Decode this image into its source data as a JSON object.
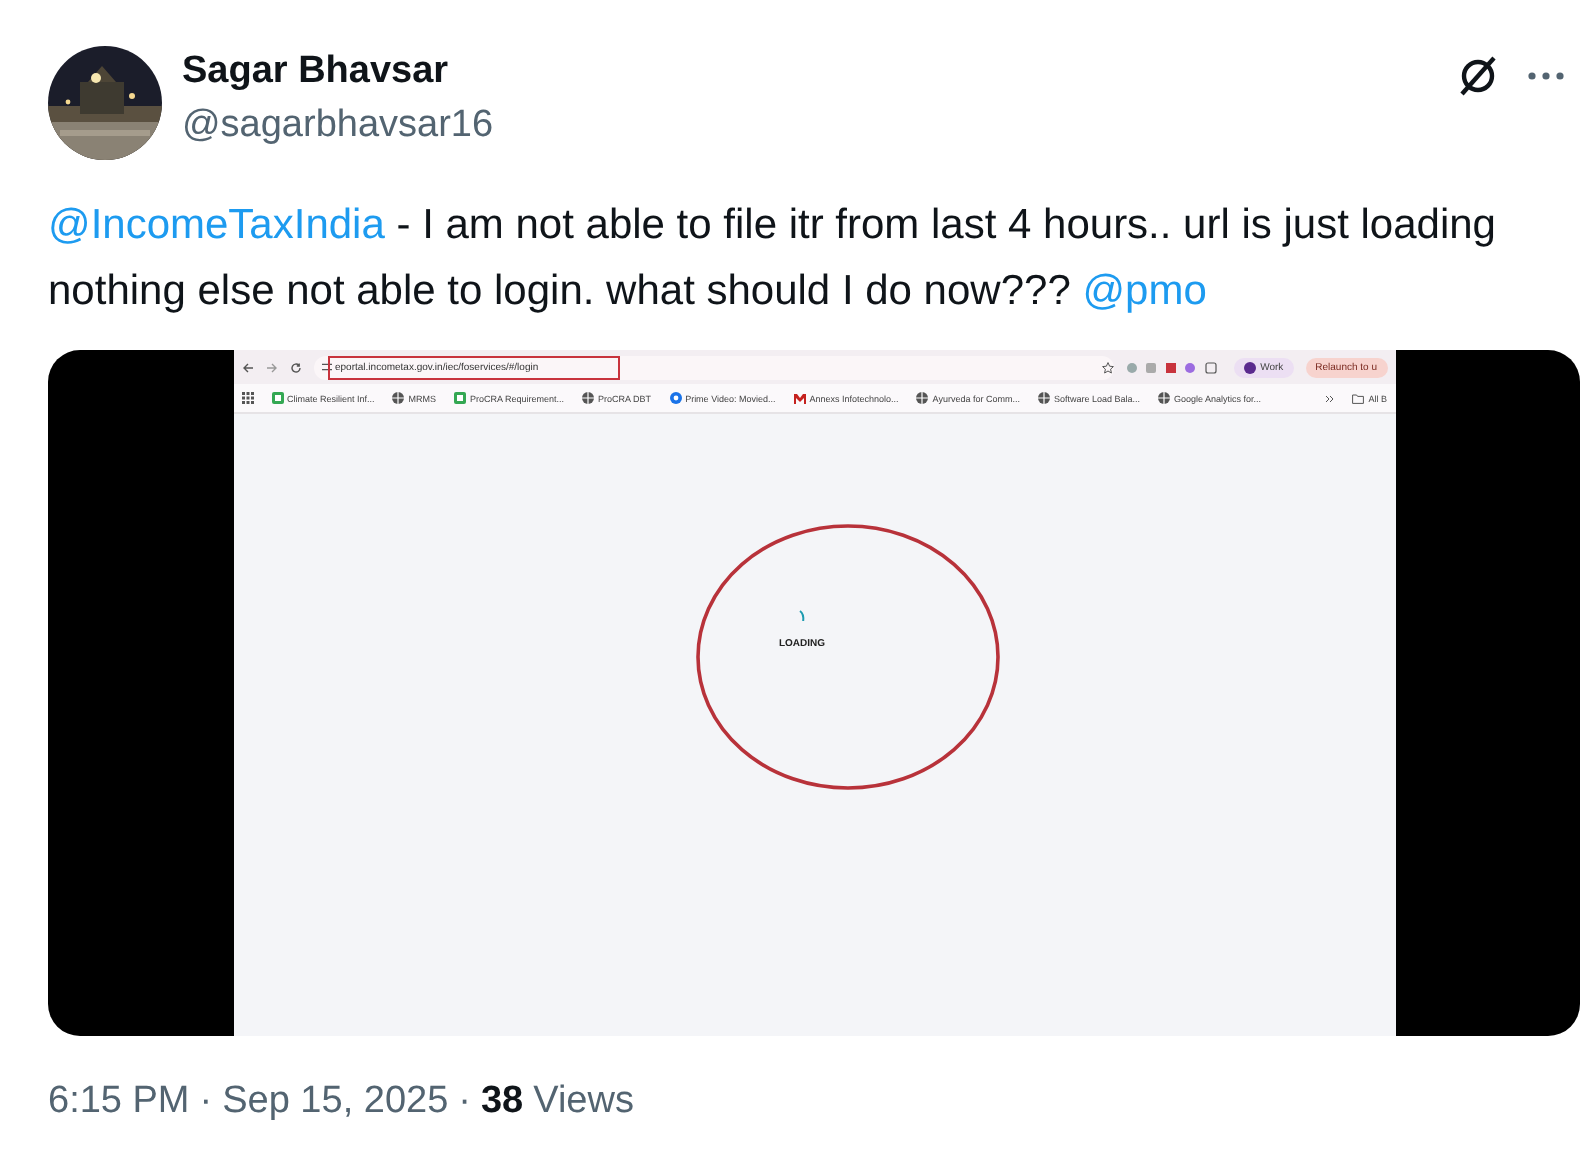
{
  "author": {
    "name": "Sagar Bhavsar",
    "handle": "@sagarbhavsar16"
  },
  "post": {
    "segments": [
      {
        "kind": "mention",
        "text": "@IncomeTaxIndia"
      },
      {
        "kind": "text",
        "text": " - I am not able to file itr from last 4 hours.. url is just loading nothing else not able to login. what should I do now??? "
      },
      {
        "kind": "mention",
        "text": "@pmo"
      }
    ]
  },
  "media": {
    "browser": {
      "url": "eportal.incometax.gov.in/iec/foservices/#/login",
      "profile": "Work",
      "update_button": "Relaunch to u",
      "bookmarks": [
        {
          "kind": "sheet",
          "text": "Climate Resilient Inf..."
        },
        {
          "kind": "globe",
          "text": "MRMS"
        },
        {
          "kind": "sheet",
          "text": "ProCRA Requirement..."
        },
        {
          "kind": "globe",
          "text": "ProCRA DBT"
        },
        {
          "kind": "video",
          "text": "Prime Video: Movied..."
        },
        {
          "kind": "mail",
          "text": "Annexs Infotechnolo..."
        },
        {
          "kind": "globe",
          "text": "Ayurveda for Comm..."
        },
        {
          "kind": "globe",
          "text": "Software Load Bala..."
        },
        {
          "kind": "globe",
          "text": "Google Analytics for..."
        }
      ],
      "other_bookmarks": "All B",
      "page_status": "LOADING"
    }
  },
  "footer": [
    {
      "kind": "plain",
      "text": "6:15 PM"
    },
    {
      "kind": "plain",
      "text": "·"
    },
    {
      "kind": "plain",
      "text": "Sep 15, 2025"
    },
    {
      "kind": "plain",
      "text": "·"
    },
    {
      "kind": "strong",
      "text": "38"
    },
    {
      "kind": "plain",
      "text": "Views"
    }
  ]
}
